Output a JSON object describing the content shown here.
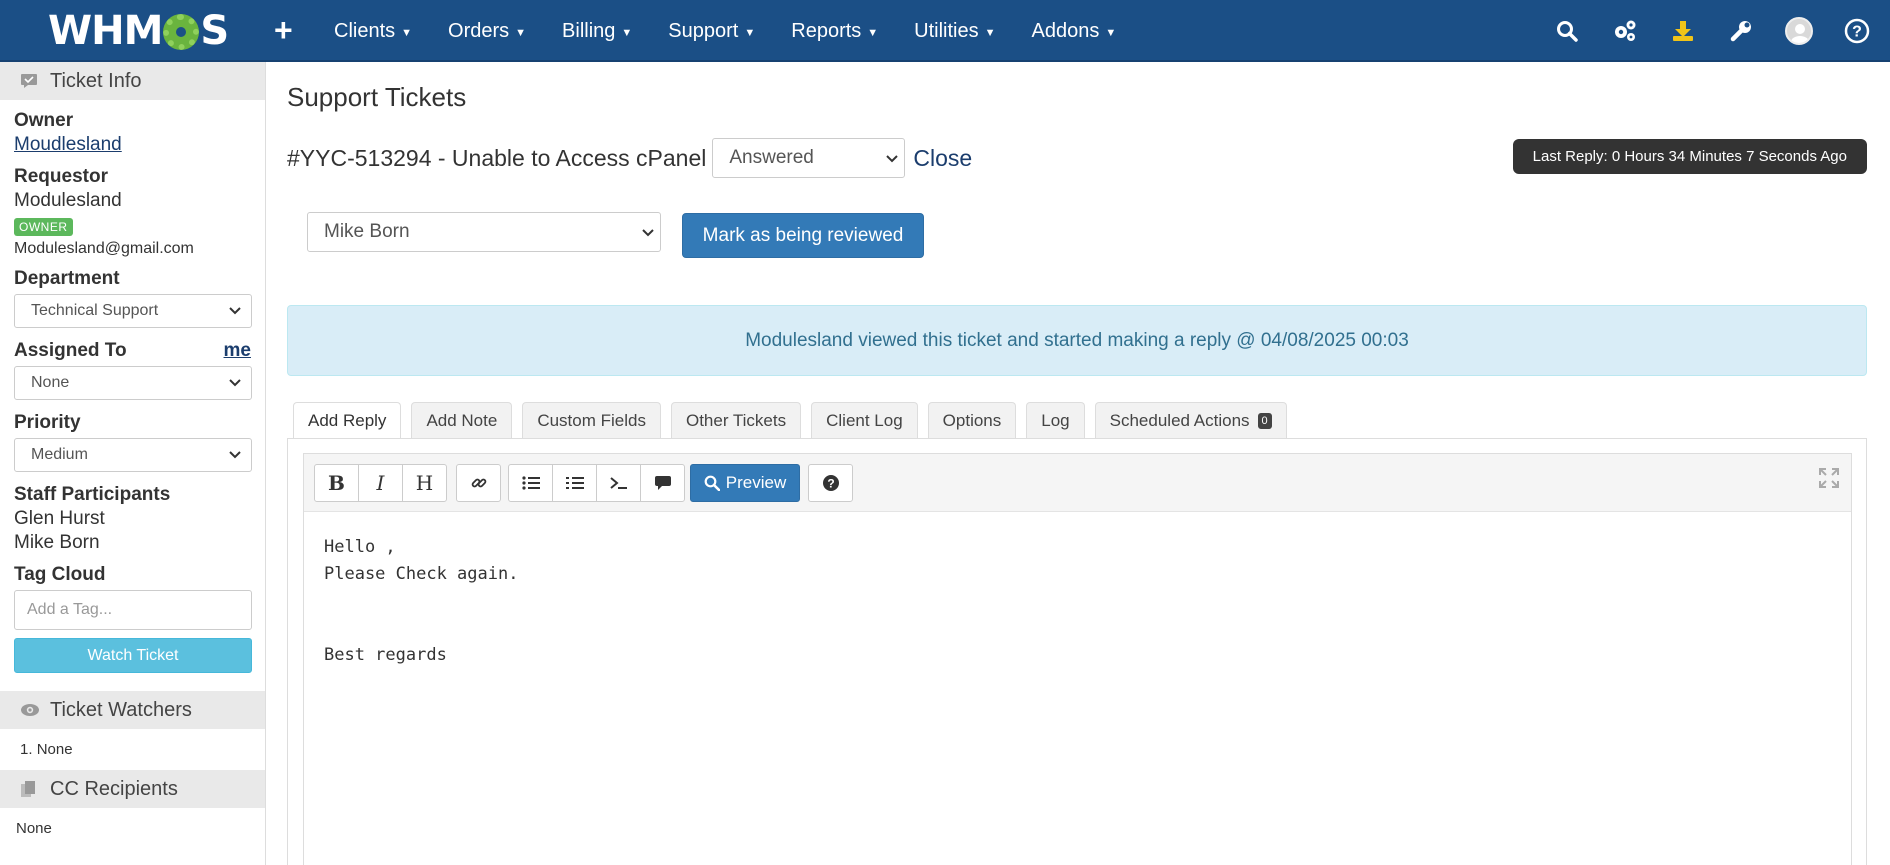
{
  "topbar": {
    "logo_text_left": "WHM",
    "logo_text_right": "S",
    "add_label": "+",
    "nav": [
      {
        "label": "Clients"
      },
      {
        "label": "Orders"
      },
      {
        "label": "Billing"
      },
      {
        "label": "Support"
      },
      {
        "label": "Reports"
      },
      {
        "label": "Utilities"
      },
      {
        "label": "Addons"
      }
    ],
    "icons": [
      "search-icon",
      "settings-gears-icon",
      "download-icon",
      "wrench-icon",
      "user-avatar-icon",
      "help-icon"
    ],
    "brand_color": "#1b4f86",
    "download_icon_color": "#f0c419"
  },
  "sidebar": {
    "ticket_info_heading": "Ticket Info",
    "owner_label": "Owner",
    "owner_value": "Moudlesland",
    "requestor_label": "Requestor",
    "requestor_value": "Modulesland",
    "owner_badge": "OWNER",
    "requestor_email": "Modulesland@gmail.com",
    "department_label": "Department",
    "department_value": "Technical Support",
    "assigned_label": "Assigned To",
    "assigned_me_link": "me",
    "assigned_value": "None",
    "priority_label": "Priority",
    "priority_value": "Medium",
    "participants_label": "Staff Participants",
    "participants": [
      "Glen Hurst",
      "Mike Born"
    ],
    "tag_cloud_label": "Tag Cloud",
    "tag_placeholder": "Add a Tag...",
    "watch_button": "Watch Ticket",
    "watchers_heading": "Ticket Watchers",
    "watchers": [
      "None"
    ],
    "cc_heading": "CC Recipients",
    "cc_value": "None"
  },
  "main": {
    "page_title": "Support Tickets",
    "ticket_title": "#YYC-513294 - Unable to Access cPanel",
    "status_value": "Answered",
    "close_link": "Close",
    "last_reply": "Last Reply: 0 Hours 34 Minutes 7 Seconds Ago",
    "assign_select_value": "Mike Born",
    "review_button": "Mark as being reviewed",
    "alert_text": "Modulesland viewed this ticket and started making a reply @ 04/08/2025 00:03",
    "tabs": [
      {
        "label": "Add Reply"
      },
      {
        "label": "Add Note"
      },
      {
        "label": "Custom Fields"
      },
      {
        "label": "Other Tickets"
      },
      {
        "label": "Client Log"
      },
      {
        "label": "Options"
      },
      {
        "label": "Log"
      },
      {
        "label": "Scheduled Actions",
        "count": "0"
      }
    ],
    "active_tab": "Add Reply",
    "toolbar": {
      "bold": "B",
      "italic": "I",
      "heading": "H",
      "preview": "Preview"
    },
    "reply_body": "Hello ,\nPlease Check again.\n\n\nBest regards"
  }
}
